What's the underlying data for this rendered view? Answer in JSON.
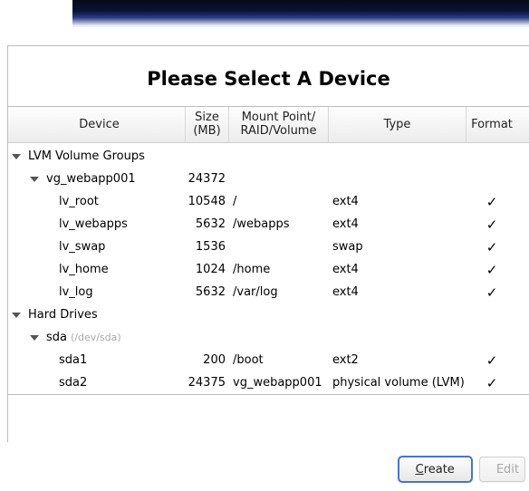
{
  "title": "Please Select A Device",
  "columns": {
    "device": "Device",
    "size": "Size\n(MB)",
    "mount": "Mount Point/\nRAID/Volume",
    "type": "Type",
    "format": "Format"
  },
  "groups": [
    {
      "label": "LVM Volume Groups",
      "children": [
        {
          "label": "vg_webapp001",
          "size": "24372",
          "children": [
            {
              "label": "lv_root",
              "size": "10548",
              "mount": "/",
              "type": "ext4",
              "format": true
            },
            {
              "label": "lv_webapps",
              "size": "5632",
              "mount": "/webapps",
              "type": "ext4",
              "format": true
            },
            {
              "label": "lv_swap",
              "size": "1536",
              "mount": "",
              "type": "swap",
              "format": true
            },
            {
              "label": "lv_home",
              "size": "1024",
              "mount": "/home",
              "type": "ext4",
              "format": true
            },
            {
              "label": "lv_log",
              "size": "5632",
              "mount": "/var/log",
              "type": "ext4",
              "format": true
            }
          ]
        }
      ]
    },
    {
      "label": "Hard Drives",
      "children": [
        {
          "label": "sda",
          "path_hint": "(/dev/sda)",
          "children": [
            {
              "label": "sda1",
              "size": "200",
              "mount": "/boot",
              "type": "ext2",
              "format": true
            },
            {
              "label": "sda2",
              "size": "24375",
              "mount": "vg_webapp001",
              "type": "physical volume (LVM)",
              "format": true
            }
          ]
        }
      ]
    }
  ],
  "buttons": {
    "create": "Create",
    "edit": "Edit"
  }
}
